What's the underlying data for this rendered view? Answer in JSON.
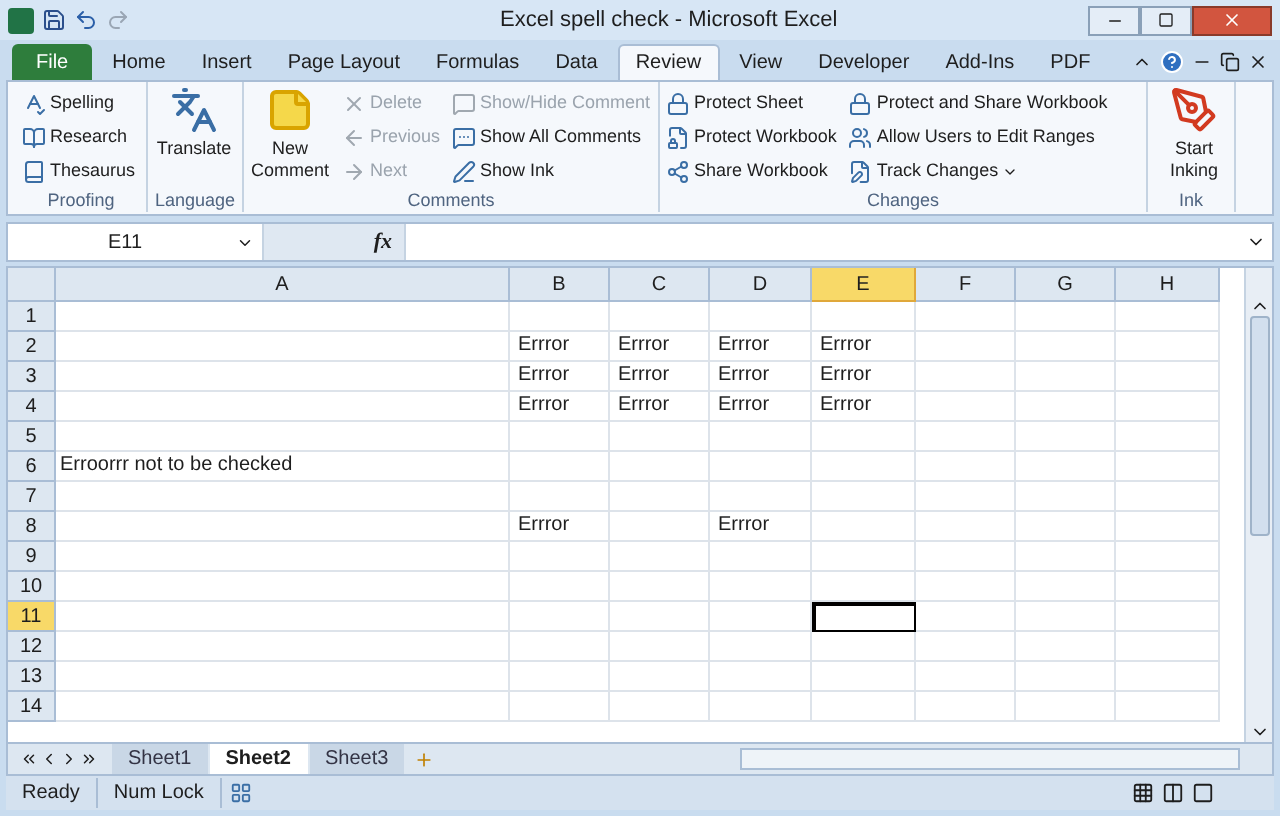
{
  "window": {
    "title": "Excel spell check - Microsoft Excel"
  },
  "tabs": [
    {
      "label": "File",
      "selected": false,
      "kind": "file"
    },
    {
      "label": "Home",
      "selected": false,
      "kind": "tab"
    },
    {
      "label": "Insert",
      "selected": false,
      "kind": "tab"
    },
    {
      "label": "Page Layout",
      "selected": false,
      "kind": "tab"
    },
    {
      "label": "Formulas",
      "selected": false,
      "kind": "tab"
    },
    {
      "label": "Data",
      "selected": false,
      "kind": "tab"
    },
    {
      "label": "Review",
      "selected": true,
      "kind": "tab"
    },
    {
      "label": "View",
      "selected": false,
      "kind": "tab"
    },
    {
      "label": "Developer",
      "selected": false,
      "kind": "tab"
    },
    {
      "label": "Add-Ins",
      "selected": false,
      "kind": "tab"
    },
    {
      "label": "PDF",
      "selected": false,
      "kind": "tab"
    }
  ],
  "ribbon_groups": [
    {
      "label": "Proofing",
      "items": [
        {
          "label": "Spelling",
          "kind": "small",
          "disabled": false
        },
        {
          "label": "Research",
          "kind": "small",
          "disabled": false
        },
        {
          "label": "Thesaurus",
          "kind": "small",
          "disabled": false
        }
      ]
    },
    {
      "label": "Language",
      "items": [
        {
          "label": "Translate",
          "kind": "large",
          "disabled": false
        }
      ]
    },
    {
      "label": "Comments",
      "items": [
        {
          "label": "New Comment",
          "kind": "large",
          "disabled": false
        },
        {
          "label": "Delete",
          "kind": "small",
          "disabled": true
        },
        {
          "label": "Previous",
          "kind": "small",
          "disabled": true
        },
        {
          "label": "Next",
          "kind": "small",
          "disabled": true
        },
        {
          "label": "Show/Hide Comment",
          "kind": "small",
          "disabled": true
        },
        {
          "label": "Show All Comments",
          "kind": "small",
          "disabled": false
        },
        {
          "label": "Show Ink",
          "kind": "small",
          "disabled": false
        }
      ]
    },
    {
      "label": "Changes",
      "items": [
        {
          "label": "Protect Sheet",
          "kind": "small",
          "disabled": false
        },
        {
          "label": "Protect Workbook",
          "kind": "small",
          "disabled": false
        },
        {
          "label": "Share Workbook",
          "kind": "small",
          "disabled": false
        },
        {
          "label": "Protect and Share Workbook",
          "kind": "small",
          "disabled": false
        },
        {
          "label": "Allow Users to Edit Ranges",
          "kind": "small",
          "disabled": false
        },
        {
          "label": "Track Changes",
          "kind": "dropdown",
          "disabled": false
        }
      ]
    },
    {
      "label": "Ink",
      "items": [
        {
          "label": "Start Inking",
          "kind": "large",
          "disabled": false
        }
      ]
    }
  ],
  "name_box": "E11",
  "function_button": "fx",
  "columns": [
    {
      "label": "A",
      "selected": false
    },
    {
      "label": "B",
      "selected": false
    },
    {
      "label": "C",
      "selected": false
    },
    {
      "label": "D",
      "selected": false
    },
    {
      "label": "E",
      "selected": true
    },
    {
      "label": "F",
      "selected": false
    },
    {
      "label": "G",
      "selected": false
    },
    {
      "label": "H",
      "selected": false
    }
  ],
  "rows": [
    {
      "label": "1",
      "selected": false,
      "cells": [
        null,
        null,
        null,
        null,
        null,
        null,
        null,
        null
      ]
    },
    {
      "label": "2",
      "selected": false,
      "cells": [
        null,
        "Errror",
        "Errror",
        "Errror",
        "Errror",
        null,
        null,
        null
      ]
    },
    {
      "label": "3",
      "selected": false,
      "cells": [
        null,
        "Errror",
        "Errror",
        "Errror",
        "Errror",
        null,
        null,
        null
      ]
    },
    {
      "label": "4",
      "selected": false,
      "cells": [
        null,
        "Errror",
        "Errror",
        "Errror",
        "Errror",
        null,
        null,
        null
      ]
    },
    {
      "label": "5",
      "selected": false,
      "cells": [
        null,
        null,
        null,
        null,
        null,
        null,
        null,
        null
      ]
    },
    {
      "label": "6",
      "selected": false,
      "cells": [
        "Erroorrr not to be checked",
        null,
        null,
        null,
        null,
        null,
        null,
        null
      ]
    },
    {
      "label": "7",
      "selected": false,
      "cells": [
        null,
        null,
        null,
        null,
        null,
        null,
        null,
        null
      ]
    },
    {
      "label": "8",
      "selected": false,
      "cells": [
        null,
        "Errror",
        null,
        "Errror",
        null,
        null,
        null,
        null
      ]
    },
    {
      "label": "9",
      "selected": false,
      "cells": [
        null,
        null,
        null,
        null,
        null,
        null,
        null,
        null
      ]
    },
    {
      "label": "10",
      "selected": false,
      "cells": [
        null,
        null,
        null,
        null,
        null,
        null,
        null,
        null
      ]
    },
    {
      "label": "11",
      "selected": true,
      "cells": [
        null,
        null,
        null,
        null,
        null,
        null,
        null,
        null
      ]
    },
    {
      "label": "12",
      "selected": false,
      "cells": [
        null,
        null,
        null,
        null,
        null,
        null,
        null,
        null
      ]
    },
    {
      "label": "13",
      "selected": false,
      "cells": [
        null,
        null,
        null,
        null,
        null,
        null,
        null,
        null
      ]
    },
    {
      "label": "14",
      "selected": false,
      "cells": [
        null,
        null,
        null,
        null,
        null,
        null,
        null,
        null
      ]
    }
  ],
  "sheet_tabs": [
    {
      "label": "Sheet1",
      "selected": false
    },
    {
      "label": "Sheet2",
      "selected": true
    },
    {
      "label": "Sheet3",
      "selected": false
    }
  ],
  "status_bar": [
    "Ready",
    "Num Lock"
  ]
}
